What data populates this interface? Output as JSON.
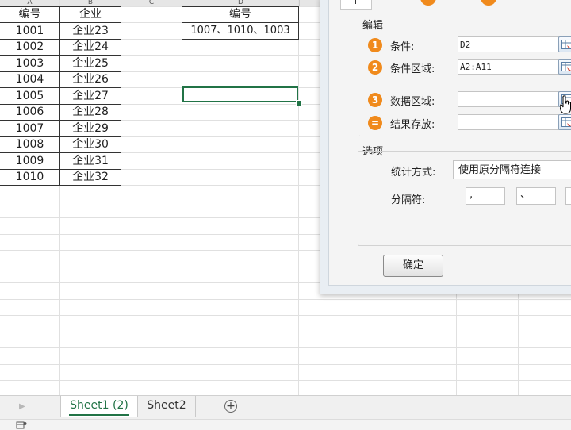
{
  "sheet": {
    "columns": [
      "A",
      "B",
      "C",
      "D"
    ],
    "header_row": {
      "col_a": "编号",
      "col_b": "企业",
      "col_d": "编号"
    },
    "rows": [
      {
        "id": "1001",
        "company": "企业23"
      },
      {
        "id": "1002",
        "company": "企业24"
      },
      {
        "id": "1003",
        "company": "企业25"
      },
      {
        "id": "1004",
        "company": "企业26"
      },
      {
        "id": "1005",
        "company": "企业27"
      },
      {
        "id": "1006",
        "company": "企业28"
      },
      {
        "id": "1007",
        "company": "企业29"
      },
      {
        "id": "1008",
        "company": "企业30"
      },
      {
        "id": "1009",
        "company": "企业31"
      },
      {
        "id": "1010",
        "company": "企业32"
      }
    ],
    "result_cell": "1007、1010、1003"
  },
  "dialog": {
    "section_edit": "编辑",
    "fields": [
      {
        "num": "1",
        "label": "条件:",
        "value": "D2"
      },
      {
        "num": "2",
        "label": "条件区域:",
        "value": "A2:A11"
      },
      {
        "num": "3",
        "label": "数据区域:",
        "value": ""
      },
      {
        "num": "=",
        "label": "结果存放:",
        "value": ""
      }
    ],
    "section_options": "选项",
    "stat_method_label": "统计方式:",
    "stat_method_value": "使用原分隔符连接",
    "separator_label": "分隔符:",
    "separator_values": [
      ",",
      "、",
      ""
    ],
    "ok_label": "确定"
  },
  "tabs": {
    "sheets": [
      "Sheet1 (2)",
      "Sheet2"
    ],
    "add_label": "+"
  },
  "colors": {
    "accent_green": "#217346",
    "step_orange": "#f08a1c"
  }
}
